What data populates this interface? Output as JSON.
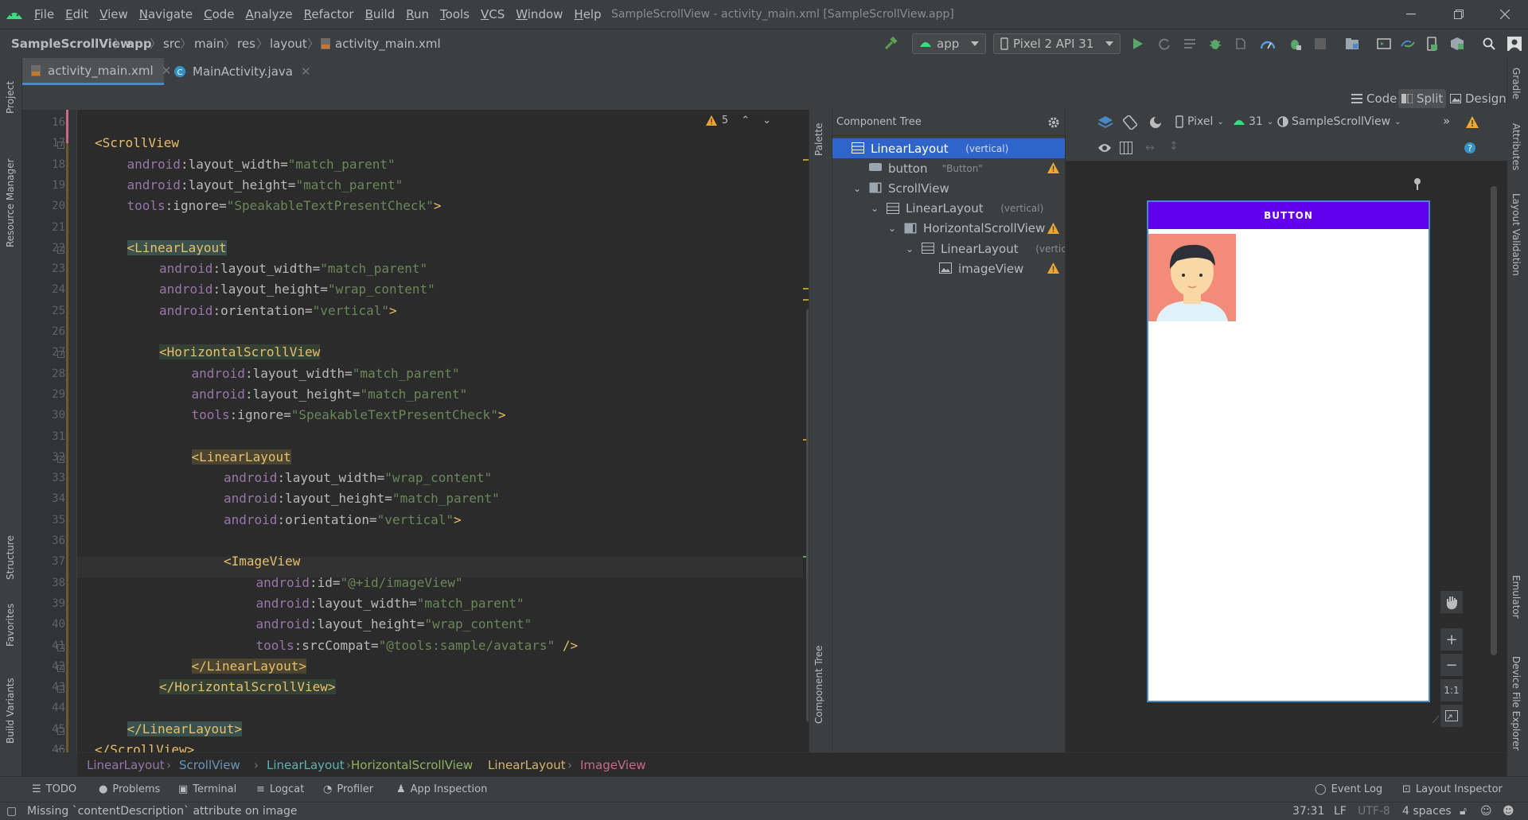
{
  "menu": [
    "File",
    "Edit",
    "View",
    "Navigate",
    "Code",
    "Analyze",
    "Refactor",
    "Build",
    "Run",
    "Tools",
    "VCS",
    "Window",
    "Help"
  ],
  "window_title": "SampleScrollView - activity_main.xml [SampleScrollView.app]",
  "breadcrumbs": [
    "SampleScrollView",
    "app",
    "src",
    "main",
    "res",
    "layout",
    "activity_main.xml"
  ],
  "run_config": "app",
  "device": "Pixel 2 API 31",
  "tabs": [
    {
      "label": "activity_main.xml",
      "active": true
    },
    {
      "label": "MainActivity.java",
      "active": false
    }
  ],
  "view_modes": [
    "Code",
    "Split",
    "Design"
  ],
  "left_tool_windows": [
    "Project",
    "Resource Manager",
    "Structure",
    "Favorites",
    "Build Variants"
  ],
  "right_tool_windows": [
    "Gradle",
    "Attributes",
    "Layout Validation",
    "Emulator",
    "Device File Explorer"
  ],
  "palette_tabs": [
    "Palette",
    "Component Tree"
  ],
  "warnings_count": "5",
  "code_lines": [
    {
      "n": "16",
      "indent": 0,
      "parts": []
    },
    {
      "n": "17",
      "indent": 0,
      "parts": [
        [
          "tag",
          "<ScrollView"
        ]
      ]
    },
    {
      "n": "18",
      "indent": 1,
      "parts": [
        [
          "ns",
          "android"
        ],
        [
          "attr",
          ":layout_width="
        ],
        [
          "str",
          "\"match_parent\""
        ]
      ]
    },
    {
      "n": "19",
      "indent": 1,
      "parts": [
        [
          "ns",
          "android"
        ],
        [
          "attr",
          ":layout_height="
        ],
        [
          "str",
          "\"match_parent\""
        ]
      ]
    },
    {
      "n": "20",
      "indent": 1,
      "parts": [
        [
          "ns",
          "tools"
        ],
        [
          "attr",
          ":ignore="
        ],
        [
          "str",
          "\"SpeakableTextPresentCheck\""
        ],
        [
          "tag",
          ">"
        ]
      ]
    },
    {
      "n": "21",
      "indent": 0,
      "parts": []
    },
    {
      "n": "22",
      "indent": 1,
      "parts": [
        [
          "taghl",
          "<LinearLayout"
        ]
      ]
    },
    {
      "n": "23",
      "indent": 2,
      "parts": [
        [
          "ns",
          "android"
        ],
        [
          "attr",
          ":layout_width="
        ],
        [
          "str",
          "\"match_parent\""
        ]
      ]
    },
    {
      "n": "24",
      "indent": 2,
      "parts": [
        [
          "ns",
          "android"
        ],
        [
          "attr",
          ":layout_height="
        ],
        [
          "str",
          "\"wrap_content\""
        ]
      ]
    },
    {
      "n": "25",
      "indent": 2,
      "parts": [
        [
          "ns",
          "android"
        ],
        [
          "attr",
          ":orientation="
        ],
        [
          "str",
          "\"vertical\""
        ],
        [
          "tag",
          ">"
        ]
      ]
    },
    {
      "n": "26",
      "indent": 0,
      "parts": []
    },
    {
      "n": "27",
      "indent": 2,
      "parts": [
        [
          "taghl2",
          "<HorizontalScrollView"
        ]
      ]
    },
    {
      "n": "28",
      "indent": 3,
      "parts": [
        [
          "ns",
          "android"
        ],
        [
          "attr",
          ":layout_width="
        ],
        [
          "str",
          "\"match_parent\""
        ]
      ]
    },
    {
      "n": "29",
      "indent": 3,
      "parts": [
        [
          "ns",
          "android"
        ],
        [
          "attr",
          ":layout_height="
        ],
        [
          "str",
          "\"match_parent\""
        ]
      ]
    },
    {
      "n": "30",
      "indent": 3,
      "parts": [
        [
          "ns",
          "tools"
        ],
        [
          "attr",
          ":ignore="
        ],
        [
          "str",
          "\"SpeakableTextPresentCheck\""
        ],
        [
          "tag",
          ">"
        ]
      ]
    },
    {
      "n": "31",
      "indent": 0,
      "parts": []
    },
    {
      "n": "32",
      "indent": 3,
      "parts": [
        [
          "taghl3",
          "<LinearLayout"
        ]
      ]
    },
    {
      "n": "33",
      "indent": 4,
      "parts": [
        [
          "ns",
          "android"
        ],
        [
          "attr",
          ":layout_width="
        ],
        [
          "str",
          "\"wrap_content\""
        ]
      ]
    },
    {
      "n": "34",
      "indent": 4,
      "parts": [
        [
          "ns",
          "android"
        ],
        [
          "attr",
          ":layout_height="
        ],
        [
          "str",
          "\"match_parent\""
        ]
      ]
    },
    {
      "n": "35",
      "indent": 4,
      "parts": [
        [
          "ns",
          "android"
        ],
        [
          "attr",
          ":orientation="
        ],
        [
          "str",
          "\"vertical\""
        ],
        [
          "tag",
          ">"
        ]
      ]
    },
    {
      "n": "36",
      "indent": 0,
      "parts": []
    },
    {
      "n": "37",
      "indent": 4,
      "parts": [
        [
          "tag",
          "<ImageView"
        ]
      ]
    },
    {
      "n": "38",
      "indent": 5,
      "parts": [
        [
          "ns",
          "android"
        ],
        [
          "attr",
          ":id="
        ],
        [
          "str",
          "\"@+id/imageView\""
        ]
      ]
    },
    {
      "n": "39",
      "indent": 5,
      "parts": [
        [
          "ns",
          "android"
        ],
        [
          "attr",
          ":layout_width="
        ],
        [
          "str",
          "\"match_parent\""
        ]
      ]
    },
    {
      "n": "40",
      "indent": 5,
      "parts": [
        [
          "ns",
          "android"
        ],
        [
          "attr",
          ":layout_height="
        ],
        [
          "str",
          "\"wrap_content\""
        ]
      ]
    },
    {
      "n": "41",
      "indent": 5,
      "parts": [
        [
          "ns",
          "tools"
        ],
        [
          "attr",
          ":srcCompat="
        ],
        [
          "str",
          "\"@tools:sample/avatars\""
        ],
        [
          "tag",
          " />"
        ]
      ]
    },
    {
      "n": "42",
      "indent": 3,
      "parts": [
        [
          "taghl3",
          "</LinearLayout>"
        ]
      ]
    },
    {
      "n": "43",
      "indent": 2,
      "parts": [
        [
          "taghl2",
          "</HorizontalScrollView>"
        ]
      ]
    },
    {
      "n": "44",
      "indent": 0,
      "parts": []
    },
    {
      "n": "45",
      "indent": 1,
      "parts": [
        [
          "taghl",
          "</LinearLayout>"
        ]
      ]
    },
    {
      "n": "46",
      "indent": 0,
      "parts": [
        [
          "tag",
          "</ScrollView>"
        ]
      ]
    }
  ],
  "component_tree": {
    "title": "Component Tree",
    "nodes": [
      {
        "label": "LinearLayout",
        "hint": "(vertical)",
        "depth": 0,
        "selected": true,
        "warn": false,
        "chev": ""
      },
      {
        "label": "button",
        "hint": "\"Button\"",
        "depth": 1,
        "selected": false,
        "warn": true,
        "chev": ""
      },
      {
        "label": "ScrollView",
        "hint": "",
        "depth": 1,
        "selected": false,
        "warn": false,
        "chev": "v"
      },
      {
        "label": "LinearLayout",
        "hint": "(vertical)",
        "depth": 2,
        "selected": false,
        "warn": false,
        "chev": "v"
      },
      {
        "label": "HorizontalScrollView",
        "hint": "",
        "depth": 3,
        "selected": false,
        "warn": true,
        "chev": "v"
      },
      {
        "label": "LinearLayout",
        "hint": "(vertical)",
        "depth": 4,
        "selected": false,
        "warn": false,
        "chev": "v"
      },
      {
        "label": "imageView",
        "hint": "",
        "depth": 5,
        "selected": false,
        "warn": true,
        "chev": ""
      }
    ]
  },
  "design_toolbar": {
    "device": "Pixel",
    "api": "31",
    "theme": "SampleScrollView"
  },
  "preview": {
    "button_label": "BUTTON",
    "button_color": "#6200ee"
  },
  "zoom_controls": [
    "+",
    "−",
    "1:1"
  ],
  "bottom_breadcrumbs": [
    "LinearLayout",
    "ScrollView",
    "LinearLayout",
    "HorizontalScrollView",
    "LinearLayout",
    "ImageView"
  ],
  "bottom_tools": [
    "TODO",
    "Problems",
    "Terminal",
    "Logcat",
    "Profiler",
    "App Inspection"
  ],
  "bottom_tools_right": [
    "Event Log",
    "Layout Inspector"
  ],
  "status": {
    "message": "Missing `contentDescription` attribute on image",
    "position": "37:31",
    "line_sep": "LF",
    "encoding": "UTF-8",
    "indent": "4 spaces"
  }
}
